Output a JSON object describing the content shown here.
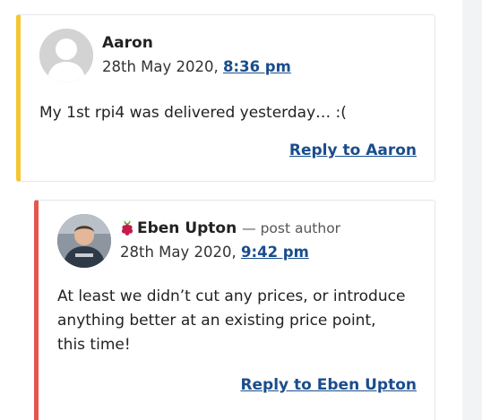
{
  "comments": [
    {
      "author": "Aaron",
      "date": "28th May 2020,",
      "time": "8:36 pm",
      "body": "My 1st rpi4 was delivered yesterday… :(",
      "reply_label": "Reply to Aaron",
      "accent": "#f5c531"
    },
    {
      "author": "Eben Upton",
      "role": "— post author",
      "date": "28th May 2020,",
      "time": "9:42 pm",
      "body": "At least we didn’t cut any prices, or introduce anything better at an existing price point, this time!",
      "reply_label": "Reply to Eben Upton",
      "accent": "#e8544e",
      "badge_icon": "raspberry-icon"
    }
  ],
  "colors": {
    "link": "#1a4d8c",
    "rail": "#f2f3f5"
  }
}
